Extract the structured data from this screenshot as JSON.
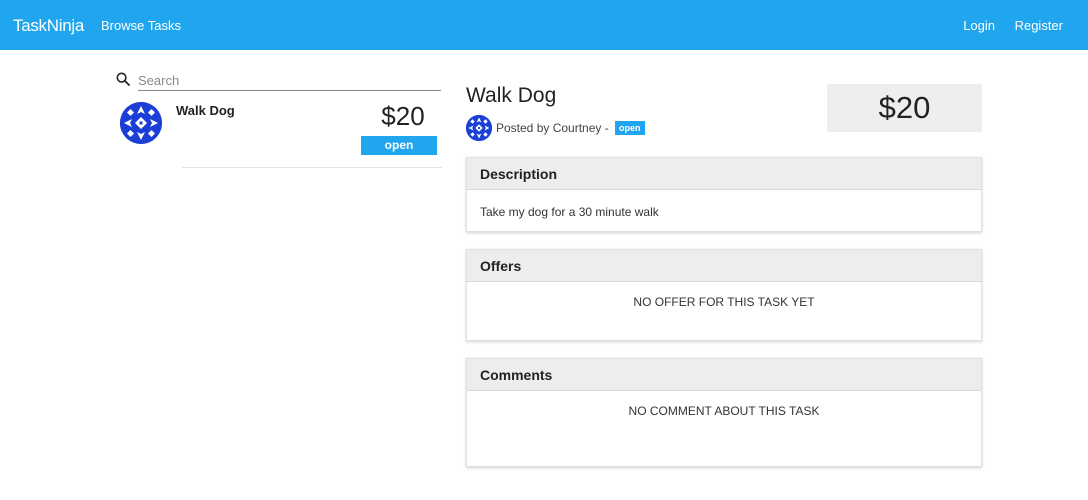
{
  "navbar": {
    "brand": "TaskNinja",
    "browse_tasks": "Browse Tasks",
    "login": "Login",
    "register": "Register",
    "color": "#1fa6ee"
  },
  "search": {
    "placeholder": "Search",
    "value": ""
  },
  "task_list": [
    {
      "title": "Walk Dog",
      "price": "$20",
      "status": "open"
    }
  ],
  "task_detail": {
    "title": "Walk Dog",
    "posted_by": "Posted by Courtney -",
    "status": "open",
    "price": "$20",
    "description_header": "Description",
    "description": "Take my dog for a 30 minute walk",
    "offers_header": "Offers",
    "offers_empty": "NO OFFER FOR THIS TASK YET",
    "comments_header": "Comments",
    "comments_empty": "NO COMMENT ABOUT THIS TASK"
  },
  "icons": {
    "search": "search-icon",
    "avatar": "avatar-pattern"
  },
  "colors": {
    "accent": "#1fa6ee",
    "avatar_blue": "#1b3fd6",
    "price_box_bg": "#eeeeee"
  }
}
